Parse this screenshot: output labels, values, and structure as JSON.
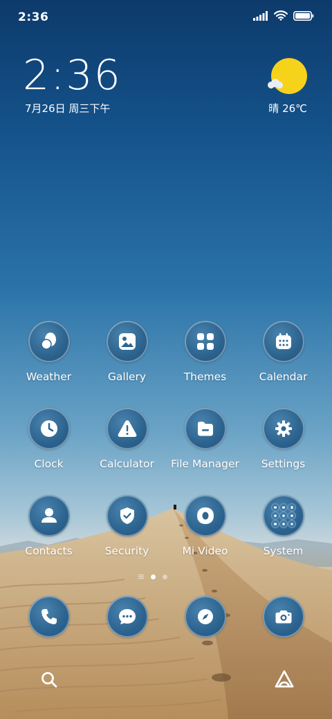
{
  "status_bar": {
    "time": "2:36"
  },
  "clock_widget": {
    "time": "2:36",
    "date": "7月26日 周三下午"
  },
  "weather_widget": {
    "text": "晴 26℃",
    "icon": "sun-cloud-icon"
  },
  "apps": [
    {
      "label": "Weather",
      "icon": "weather-icon"
    },
    {
      "label": "Gallery",
      "icon": "gallery-icon"
    },
    {
      "label": "Themes",
      "icon": "themes-icon"
    },
    {
      "label": "Calendar",
      "icon": "calendar-icon"
    },
    {
      "label": "Clock",
      "icon": "clock-icon"
    },
    {
      "label": "Calculator",
      "icon": "warning-icon"
    },
    {
      "label": "File Manager",
      "icon": "folder-icon"
    },
    {
      "label": "Settings",
      "icon": "gear-icon"
    },
    {
      "label": "Contacts",
      "icon": "person-icon"
    },
    {
      "label": "Security",
      "icon": "shield-icon"
    },
    {
      "label": "Mi Video",
      "icon": "video-icon"
    },
    {
      "label": "System",
      "icon": "folder-grid-icon"
    }
  ],
  "page_indicator": {
    "pages": 3,
    "active": 2
  },
  "dock": [
    {
      "icon": "phone-icon"
    },
    {
      "icon": "messages-icon"
    },
    {
      "icon": "compass-icon"
    },
    {
      "icon": "camera-icon"
    }
  ],
  "colors": {
    "icon_fill": "#2d6590",
    "sun": "#f7d21b"
  }
}
